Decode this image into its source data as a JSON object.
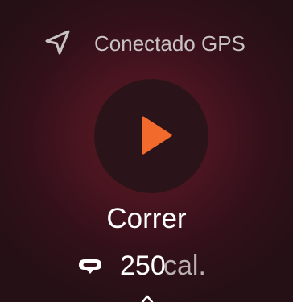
{
  "status": {
    "icon": "navigation-arrow-icon",
    "text": "Conectado GPS"
  },
  "workout": {
    "start_icon": "play-icon",
    "activity": "Correr",
    "calorie_icon": "calorie-goal-icon",
    "calories_value": "250",
    "calories_unit": "cal."
  },
  "scroll_hint_icon": "chevron-up-icon",
  "colors": {
    "accent": "#f26a2c",
    "background": "#3a1219",
    "button": "#2b1419",
    "text_primary": "#ffffff",
    "text_secondary": "#c9c2c4"
  }
}
